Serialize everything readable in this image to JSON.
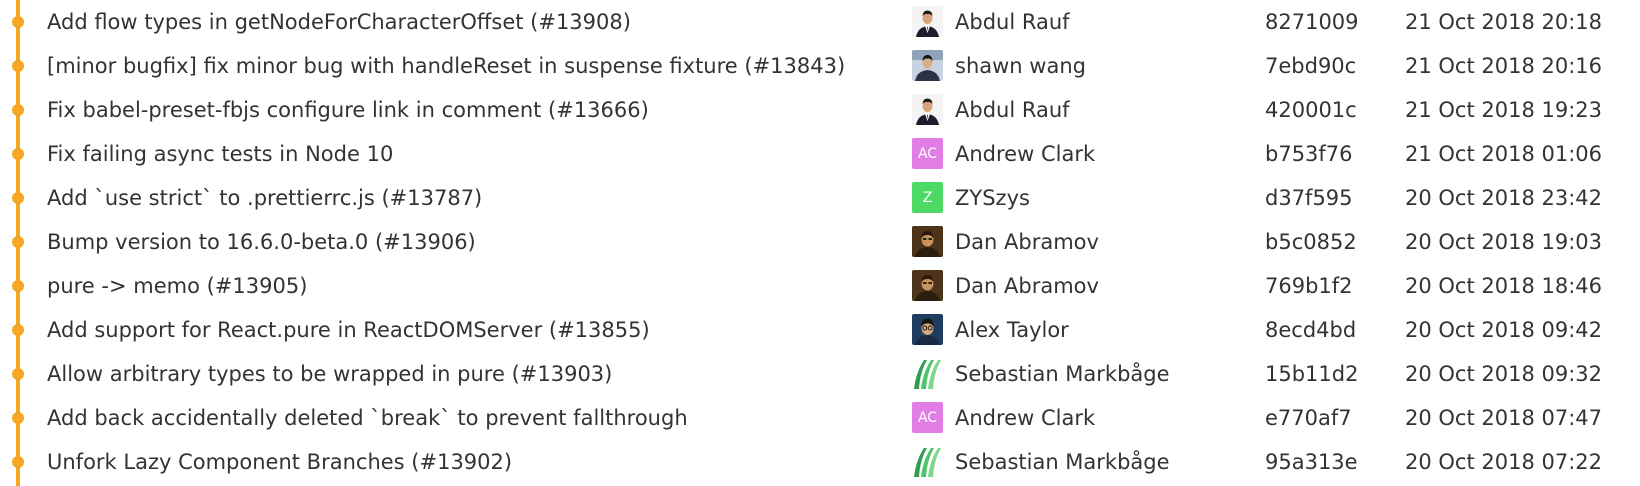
{
  "colors": {
    "graph_line": "#f5a623",
    "text": "#333333",
    "avatar_initials_purple": "#e07ee6",
    "avatar_initials_green": "#4cd964"
  },
  "commits": [
    {
      "message": "Add flow types in getNodeForCharacterOffset (#13908)",
      "author": "Abdul Rauf",
      "avatar": "photo-suit-icon",
      "hash": "8271009",
      "date": "21 Oct 2018 20:18"
    },
    {
      "message": "[minor bugfix] fix minor bug with handleReset in suspense fixture (#13843)",
      "author": "shawn wang",
      "avatar": "photo-shawn-icon",
      "hash": "7ebd90c",
      "date": "21 Oct 2018 20:16"
    },
    {
      "message": "Fix babel-preset-fbjs configure link in comment (#13666)",
      "author": "Abdul Rauf",
      "avatar": "photo-suit-icon",
      "hash": "420001c",
      "date": "21 Oct 2018 19:23"
    },
    {
      "message": "Fix failing async tests in Node 10",
      "author": "Andrew Clark",
      "avatar": "initials-ac",
      "initials": "AC",
      "hash": "b753f76",
      "date": "21 Oct 2018 01:06"
    },
    {
      "message": "Add `use strict` to .prettierrc.js (#13787)",
      "author": "ZYSzys",
      "avatar": "initials-z",
      "initials": "Z",
      "hash": "d37f595",
      "date": "20 Oct 2018 23:42"
    },
    {
      "message": "Bump version to 16.6.0-beta.0 (#13906)",
      "author": "Dan Abramov",
      "avatar": "photo-dan-icon",
      "hash": "b5c0852",
      "date": "20 Oct 2018 19:03"
    },
    {
      "message": "pure -> memo (#13905)",
      "author": "Dan Abramov",
      "avatar": "photo-dan-icon",
      "hash": "769b1f2",
      "date": "20 Oct 2018 18:46"
    },
    {
      "message": "Add support for React.pure in ReactDOMServer (#13855)",
      "author": "Alex Taylor",
      "avatar": "photo-alex-icon",
      "hash": "8ecd4bd",
      "date": "20 Oct 2018 09:42"
    },
    {
      "message": "Allow arbitrary types to be wrapped in pure (#13903)",
      "author": "Sebastian Markbåge",
      "avatar": "green-stripes-icon",
      "hash": "15b11d2",
      "date": "20 Oct 2018 09:32"
    },
    {
      "message": "Add back accidentally deleted `break` to prevent fallthrough",
      "author": "Andrew Clark",
      "avatar": "initials-ac",
      "initials": "AC",
      "hash": "e770af7",
      "date": "20 Oct 2018 07:47"
    },
    {
      "message": "Unfork Lazy Component Branches (#13902)",
      "author": "Sebastian Markbåge",
      "avatar": "green-stripes-icon",
      "hash": "95a313e",
      "date": "20 Oct 2018 07:22"
    }
  ]
}
